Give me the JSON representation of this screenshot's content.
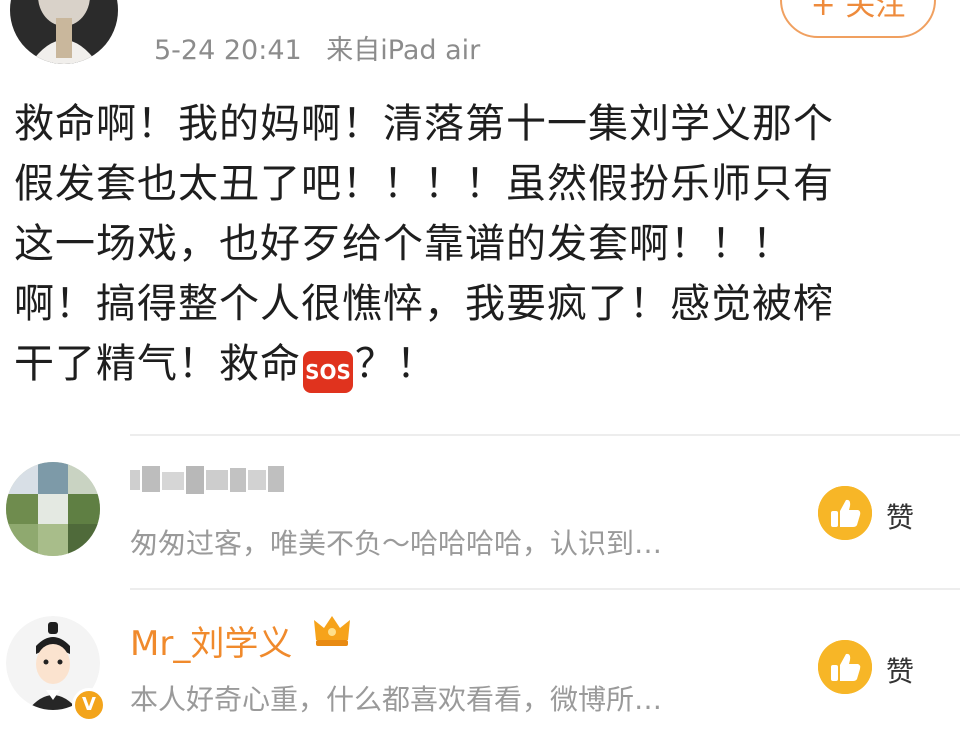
{
  "post": {
    "meta": {
      "time": "5-24 20:41",
      "source": "来自iPad air"
    },
    "follow_label": "+ 关注",
    "text_lines": [
      "救命啊！我的妈啊！清落第十一集刘学义那个",
      "假发套也太丑了吧！！！！虽然假扮乐师只有",
      "这一场戏，也好歹给个靠谱的发套啊！！！",
      "啊！搞得整个人很憔悴，我要疯了！感觉被榨"
    ],
    "last_line_before_emoji": "干了精气！救命",
    "emoji_label": "SOS",
    "last_line_after_emoji": "？！"
  },
  "comments": [
    {
      "name": "",
      "bio": "匆匆过客，唯美不负～哈哈哈哈，认识到…",
      "like_label": "赞"
    },
    {
      "name": "Mr_刘学义",
      "bio": "本人好奇心重，什么都喜欢看看，微博所…",
      "like_label": "赞",
      "badge": "V"
    }
  ],
  "colors": {
    "accent": "#f08a2c",
    "like": "#f7b627",
    "sos": "#e0331e",
    "meta_gray": "#8c8c8c"
  }
}
